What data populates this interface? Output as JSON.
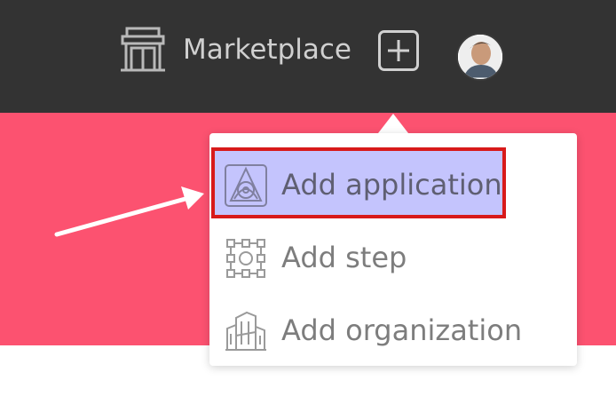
{
  "header": {
    "marketplace_label": "Marketplace",
    "marketplace_icon": "storefront-icon",
    "add_icon": "plus-square-icon",
    "avatar_icon": "user-avatar"
  },
  "add_menu": {
    "items": [
      {
        "label": "Add application",
        "icon": "application-icon",
        "highlighted": true
      },
      {
        "label": "Add step",
        "icon": "step-icon"
      },
      {
        "label": "Add organization",
        "icon": "organization-icon"
      }
    ]
  },
  "colors": {
    "header_bg": "#333333",
    "banner_bg": "#fc5270",
    "highlight_fill": "#c4c4fd",
    "highlight_border": "#d81a1a",
    "menu_text": "#7d7d7d"
  },
  "annotation": {
    "type": "arrow",
    "points_to": "Add application"
  }
}
